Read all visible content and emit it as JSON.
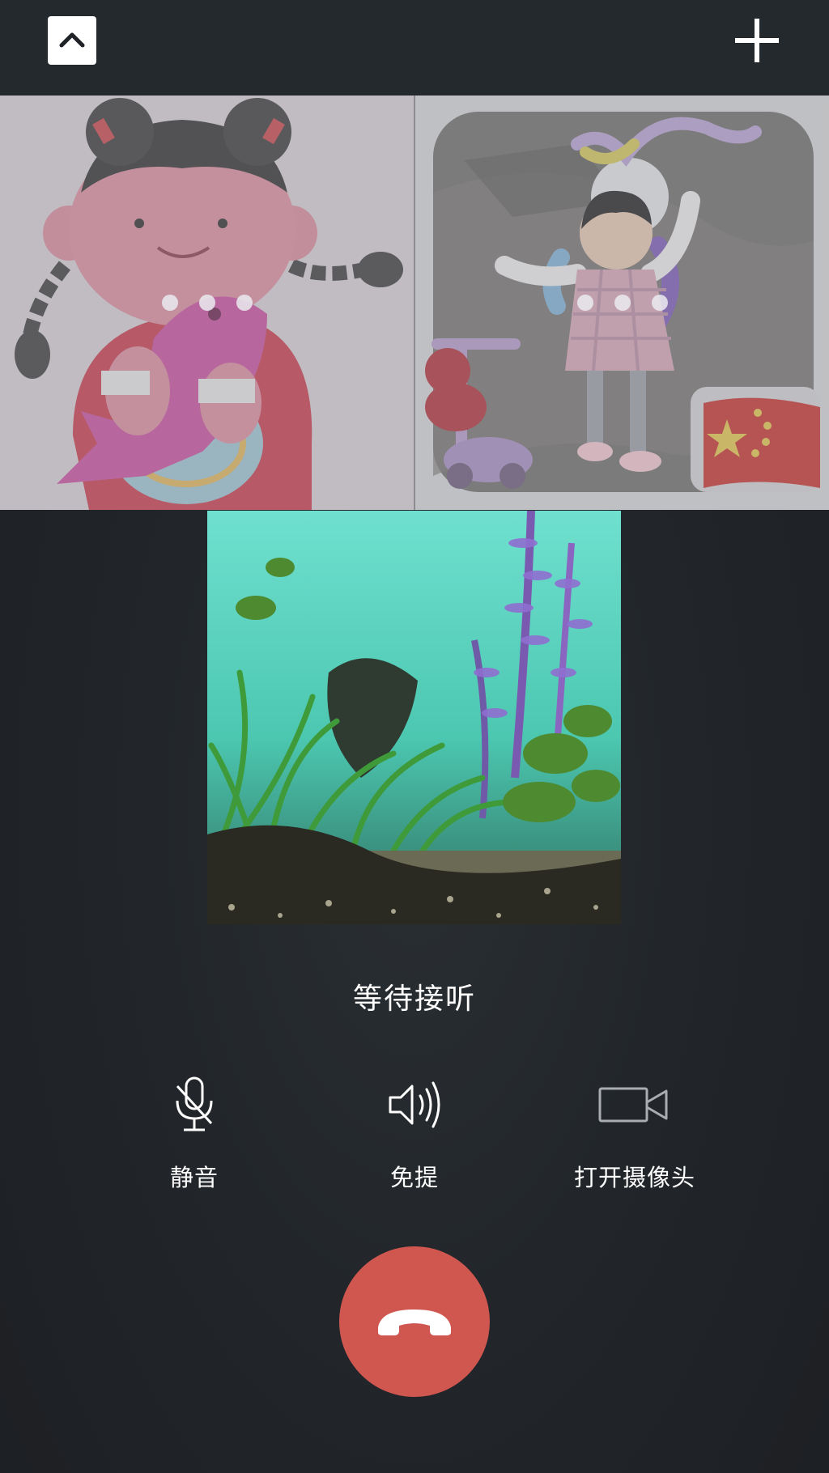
{
  "header": {
    "collapse_icon": "chevron-up-icon",
    "add_icon": "plus-icon"
  },
  "participants": [
    {
      "type": "avatar-illustration",
      "status": "connecting"
    },
    {
      "type": "avatar-photo",
      "status": "connecting"
    }
  ],
  "self_video": {
    "content": "camera-preview"
  },
  "status_text": "等待接听",
  "controls": {
    "mute_label": "静音",
    "mute_icon": "microphone-muted-icon",
    "speaker_label": "免提",
    "speaker_icon": "speaker-icon",
    "camera_label": "打开摄像头",
    "camera_icon": "video-camera-icon"
  },
  "hangup": {
    "icon": "hang-up-phone-icon",
    "color": "#d0574f"
  },
  "colors": {
    "background": "#1f2226",
    "topbar": "#23292c",
    "text": "#ffffff",
    "icon": "#ffffff"
  }
}
